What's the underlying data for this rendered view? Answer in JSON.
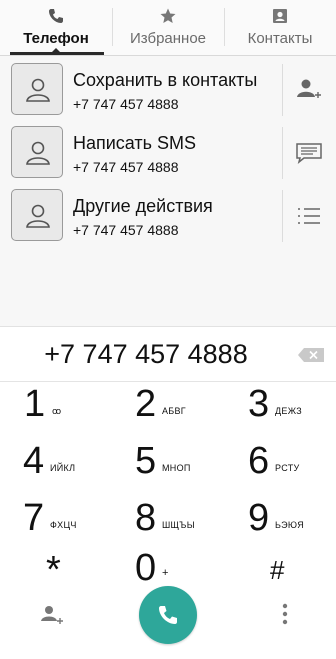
{
  "tabs": [
    {
      "label": "Телефон",
      "icon": "phone-icon",
      "active": true
    },
    {
      "label": "Избранное",
      "icon": "star-icon",
      "active": false
    },
    {
      "label": "Контакты",
      "icon": "contacts-icon",
      "active": false
    }
  ],
  "actions": [
    {
      "title": "Сохранить в контакты",
      "number": "+7 747 457 4888",
      "side_icon": "add-contact-icon"
    },
    {
      "title": "Написать SMS",
      "number": "+7 747 457 4888",
      "side_icon": "message-icon"
    },
    {
      "title": "Другие действия",
      "number": "+7 747 457 4888",
      "side_icon": "list-icon"
    }
  ],
  "dialer": {
    "number": "+7 747 457 4888"
  },
  "keypad": [
    {
      "digit": "1",
      "letters": "ꝏ"
    },
    {
      "digit": "2",
      "letters": "АБВГ"
    },
    {
      "digit": "3",
      "letters": "ДЕЖЗ"
    },
    {
      "digit": "4",
      "letters": "ИЙКЛ"
    },
    {
      "digit": "5",
      "letters": "МНОП"
    },
    {
      "digit": "6",
      "letters": "РСТУ"
    },
    {
      "digit": "7",
      "letters": "ФХЦЧ"
    },
    {
      "digit": "8",
      "letters": "ШЩЪЫ"
    },
    {
      "digit": "9",
      "letters": "ЬЭЮЯ"
    },
    {
      "digit": "*",
      "letters": ""
    },
    {
      "digit": "0",
      "letters": "+"
    },
    {
      "digit": "#",
      "letters": ""
    }
  ],
  "colors": {
    "call_button": "#2ea79a",
    "tab_background": "#fafafa"
  }
}
